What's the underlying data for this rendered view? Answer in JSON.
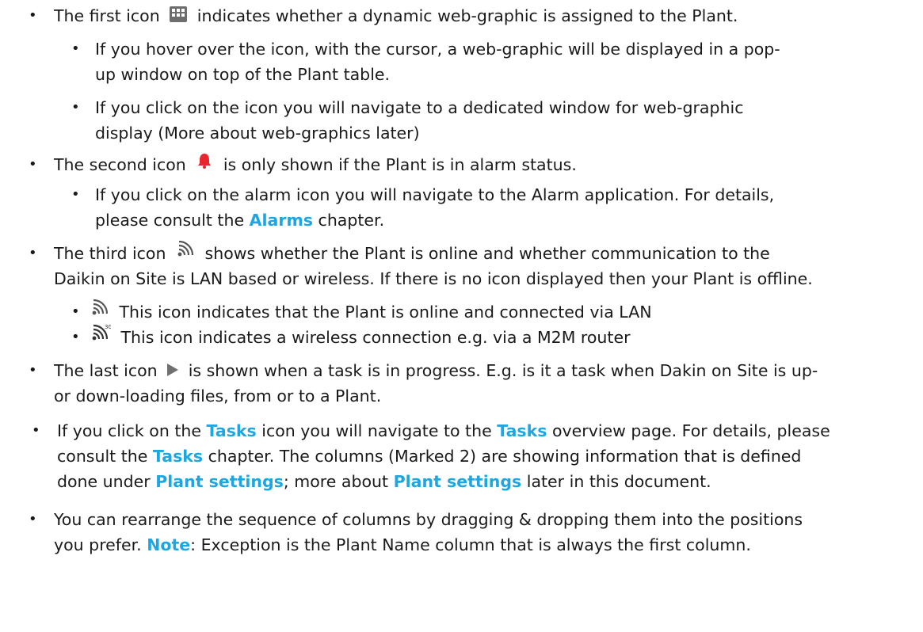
{
  "lines": {
    "b1_pre": "The first icon",
    "b1_post": "indicates whether a dynamic web-graphic is assigned to the Plant.",
    "b1a_l1": "If you hover over the icon, with the cursor, a web-graphic will be displayed in a pop-",
    "b1a_l2": "up window on top of the Plant table.",
    "b1b_l1": "If you click on the icon you will navigate to a dedicated window for web-graphic",
    "b1b_l2": "display (More about web-graphics later)",
    "b2_pre": "The second icon",
    "b2_post": "is only shown if the Plant is in alarm status.",
    "b2a_l1": "If you click on the alarm icon you will navigate to the Alarm application. For details,",
    "b2a_l2_pre": "please consult the",
    "b2a_l2_link": "Alarms",
    "b2a_l2_post": "chapter.",
    "b3_pre": "The third icon",
    "b3_post": "shows whether the Plant is online and whether communication to the",
    "b3_l2": "Daikin on Site is LAN based or wireless. If there is no icon displayed then your Plant is offline.",
    "b3a": "This icon indicates that the Plant is online and connected via LAN",
    "b3b": "This icon indicates a wireless connection e.g. via a M2M router",
    "b4_pre": "The last icon",
    "b4_post": "is shown when a task is in progress. E.g. is it a task when Dakin on Site is up-",
    "b4_l2": "or down-loading files, from or to a Plant.",
    "b5_l1_pre": "If you click on the",
    "b5_l1_link1": "Tasks",
    "b5_l1_mid": "icon you will navigate to the",
    "b5_l1_link2": "Tasks",
    "b5_l1_post": "overview page. For details, please",
    "b5_l2_pre": "consult the",
    "b5_l2_link": "Tasks",
    "b5_l2_post": "chapter. The columns (Marked 2) are showing information that is defined",
    "b5_l3_pre": "done under",
    "b5_l3_link1": "Plant settings",
    "b5_l3_mid": "; more about",
    "b5_l3_link2": "Plant settings",
    "b5_l3_post": "later in this document.",
    "b6_l1": "You can rearrange the sequence of columns by dragging & dropping them into the positions",
    "b6_l2_pre": "you prefer.",
    "b6_l2_link": "Note",
    "b6_l2_post": ": Exception is the Plant Name column that is always the first column."
  },
  "bullet_char": "•",
  "icons": {
    "grid": "grid-icon",
    "alarm": "bell-icon",
    "signal": "signal-icon",
    "signal_3g": "signal-3g-icon",
    "play": "play-icon"
  },
  "colors": {
    "link": "#1ea6e1",
    "alarm": "#e8262f",
    "icon": "#6d6d6d"
  }
}
